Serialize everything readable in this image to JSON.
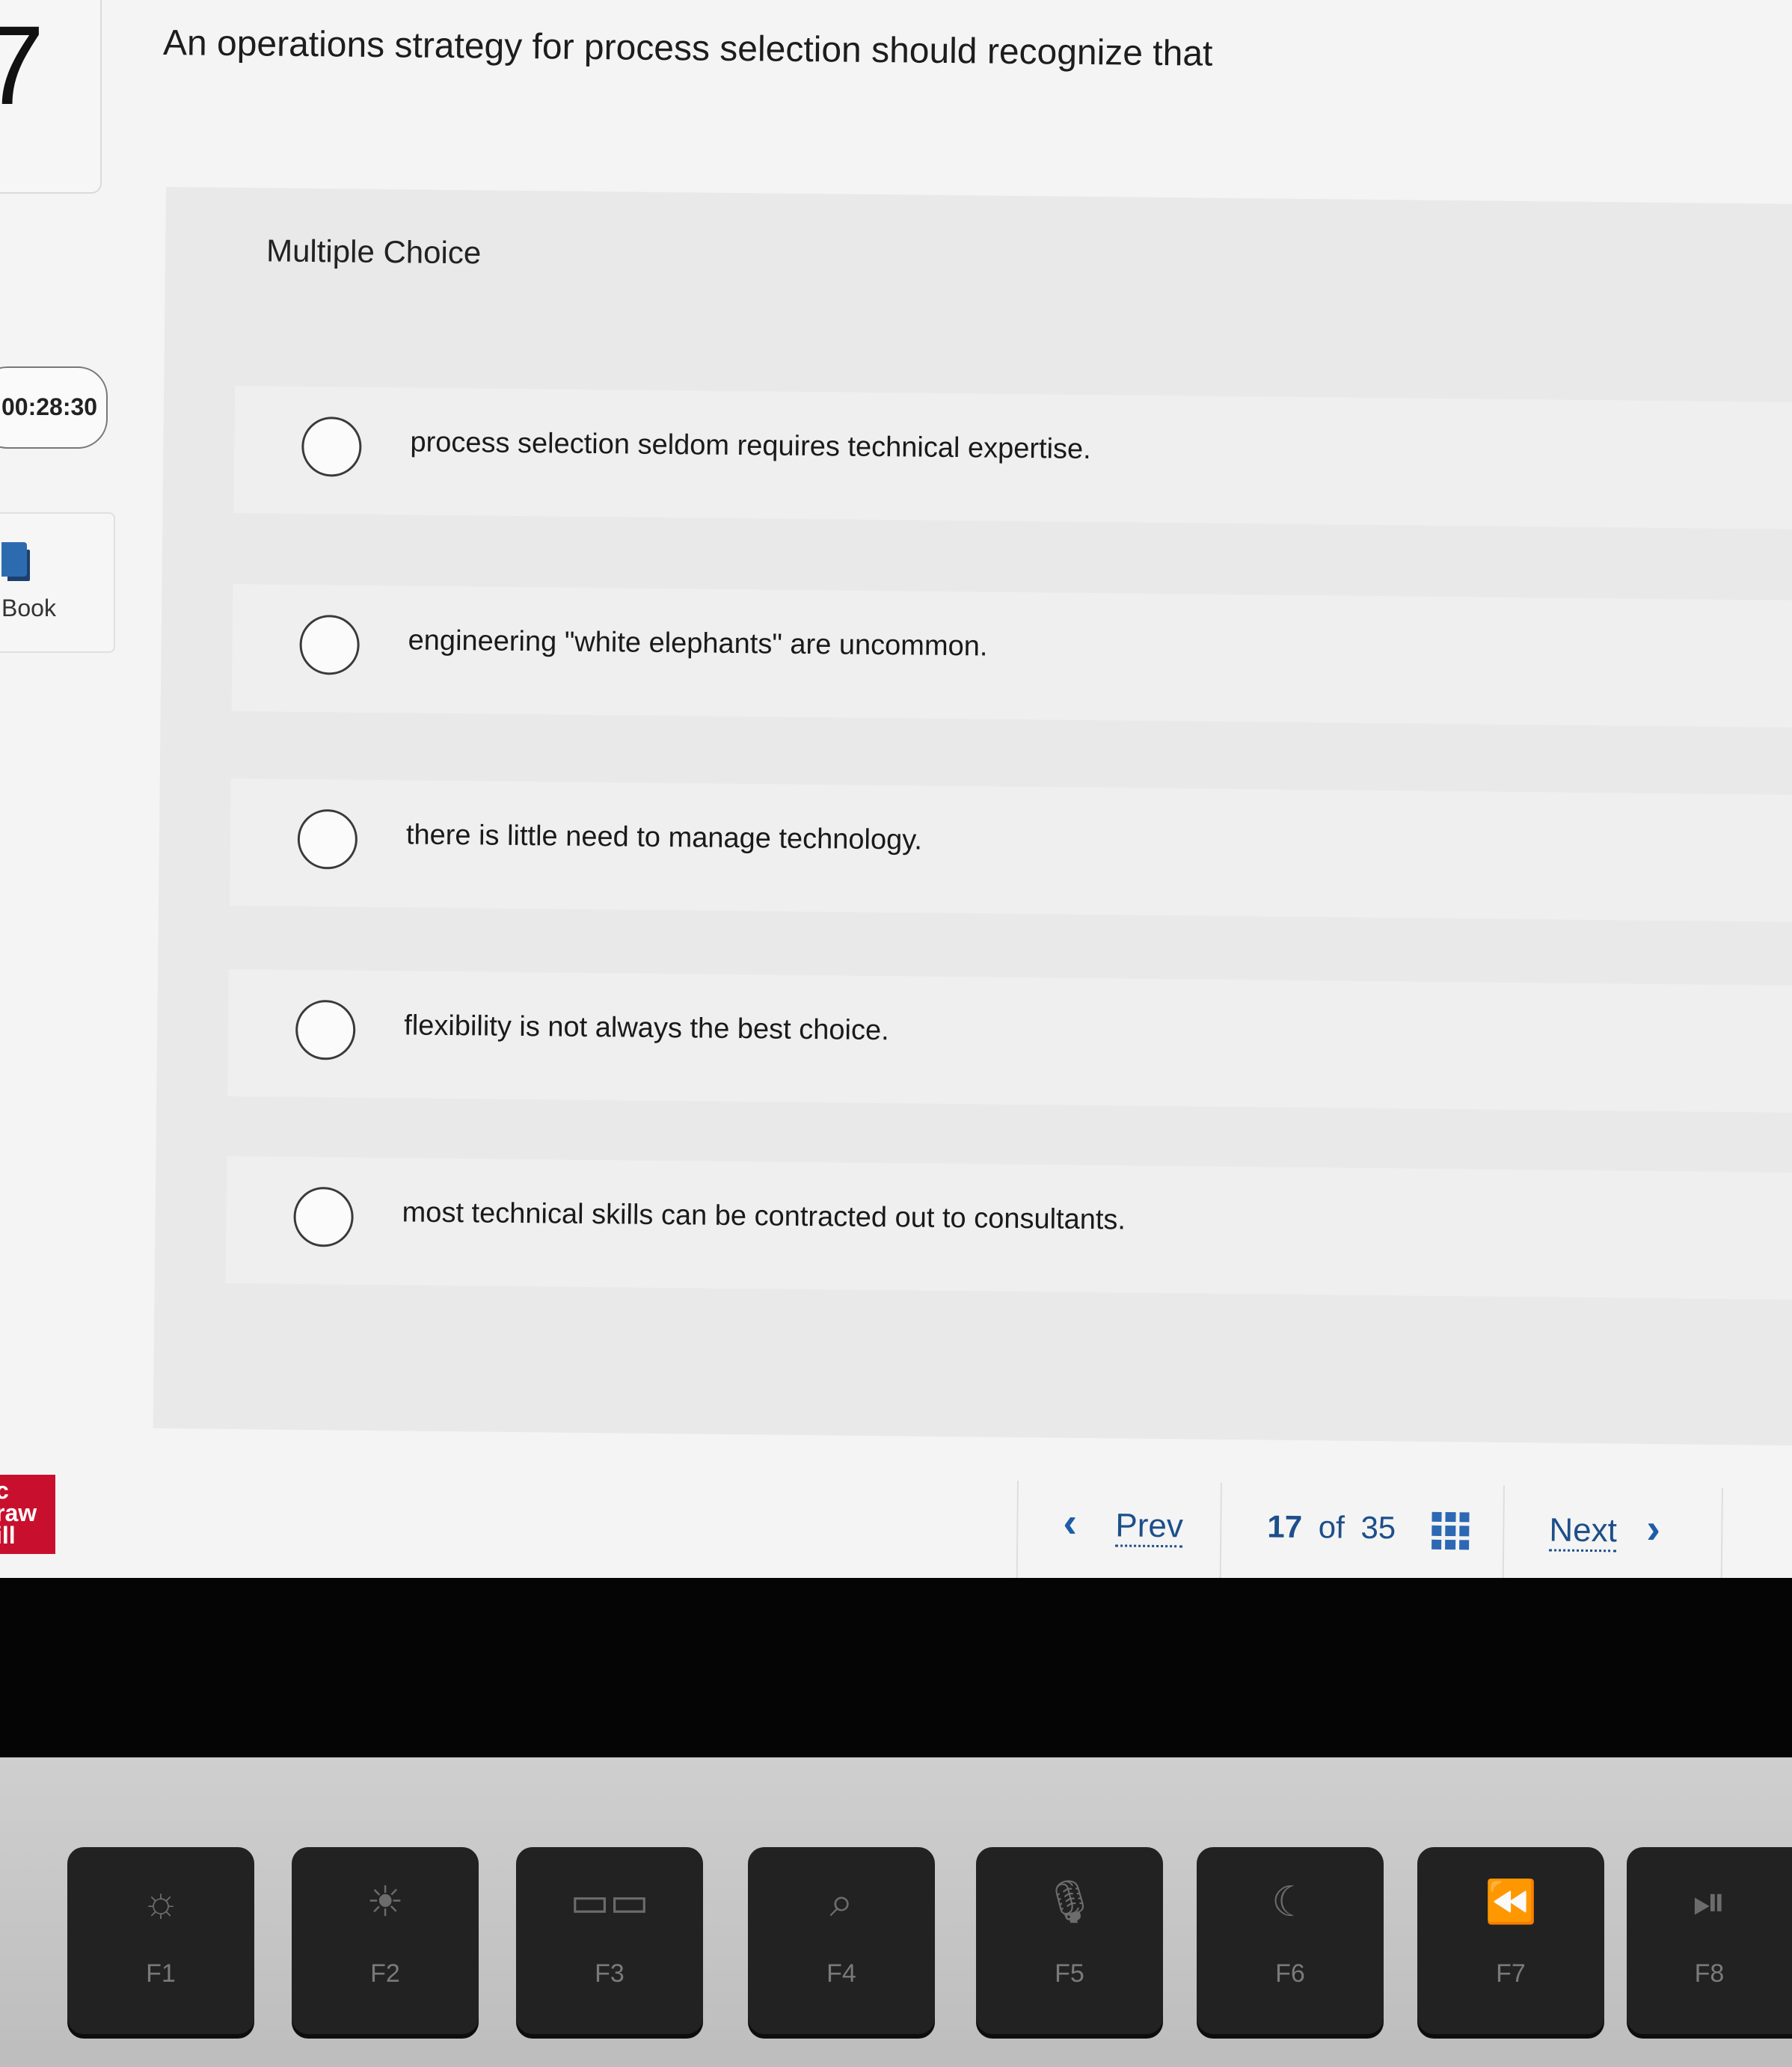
{
  "question": {
    "number": "7",
    "text": "An operations strategy for process selection should recognize that"
  },
  "sidebar": {
    "timer": "00:28:30",
    "ebook_label": "Book",
    "logo_text": "c\nraw\nill"
  },
  "answer": {
    "type_label": "Multiple Choice",
    "options": [
      {
        "text": "process selection seldom requires technical expertise."
      },
      {
        "text": "engineering \"white elephants\" are uncommon."
      },
      {
        "text": "there is little need to manage technology."
      },
      {
        "text": "flexibility is not always the best choice."
      },
      {
        "text": "most technical skills can be contracted out to consultants."
      }
    ]
  },
  "navigation": {
    "prev_label": "Prev",
    "current": "17",
    "of_label": "of",
    "total": "35",
    "next_label": "Next"
  },
  "keyboard": {
    "keys": [
      {
        "label": "F1",
        "icon": "brightness-down-icon",
        "glyph": "☼"
      },
      {
        "label": "F2",
        "icon": "brightness-up-icon",
        "glyph": "☀"
      },
      {
        "label": "F3",
        "icon": "mission-control-icon",
        "glyph": "▭▭"
      },
      {
        "label": "F4",
        "icon": "search-icon",
        "glyph": "⌕"
      },
      {
        "label": "F5",
        "icon": "microphone-icon",
        "glyph": "🎙"
      },
      {
        "label": "F6",
        "icon": "moon-icon",
        "glyph": "☾"
      },
      {
        "label": "F7",
        "icon": "rewind-icon",
        "glyph": "⏪"
      },
      {
        "label": "F8",
        "icon": "play-pause-icon",
        "glyph": "⏯"
      }
    ]
  },
  "colors": {
    "accent": "#1d5da8",
    "brand_red": "#c8102e"
  }
}
